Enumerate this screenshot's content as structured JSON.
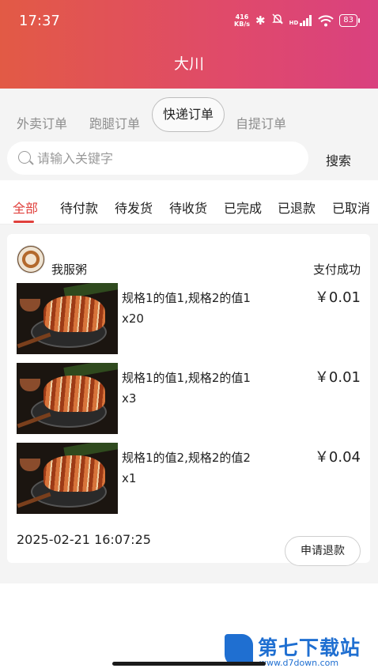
{
  "status_bar": {
    "time": "17:37",
    "net_speed_value": "416",
    "net_speed_unit": "KB/s",
    "bluetooth_icon": "bluetooth-icon",
    "mute_icon": "bell-off-icon",
    "hd_label": "HD",
    "signal_icon": "signal-icon",
    "wifi_icon": "wifi-icon",
    "battery": "83"
  },
  "header": {
    "title": "大川"
  },
  "order_type_tabs": [
    {
      "label": "外卖订单",
      "active": false
    },
    {
      "label": "跑腿订单",
      "active": false
    },
    {
      "label": "快递订单",
      "active": true
    },
    {
      "label": "自提订单",
      "active": false
    }
  ],
  "search": {
    "placeholder": "请输入关键字",
    "button_label": "搜索"
  },
  "status_tabs": [
    {
      "label": "全部",
      "active": true
    },
    {
      "label": "待付款",
      "active": false
    },
    {
      "label": "待发货",
      "active": false
    },
    {
      "label": "待收货",
      "active": false
    },
    {
      "label": "已完成",
      "active": false
    },
    {
      "label": "已退款",
      "active": false
    },
    {
      "label": "已取消",
      "active": false
    }
  ],
  "order": {
    "shop_name": "我服粥",
    "status": "支付成功",
    "items": [
      {
        "spec": "规格1的值1,规格2的值1",
        "qty": "x20",
        "price": "￥0.01"
      },
      {
        "spec": "规格1的值1,规格2的值1",
        "qty": "x3",
        "price": "￥0.01"
      },
      {
        "spec": "规格1的值2,规格2的值2",
        "qty": "x1",
        "price": "￥0.04"
      }
    ],
    "time": "2025-02-21 16:07:25",
    "refund_label": "申请退款"
  },
  "watermark": {
    "text": "第七下载站",
    "url": "www.d7down.com"
  },
  "colors": {
    "header_start": "#e25a45",
    "header_end": "#d9417f",
    "accent": "#e0403c"
  }
}
